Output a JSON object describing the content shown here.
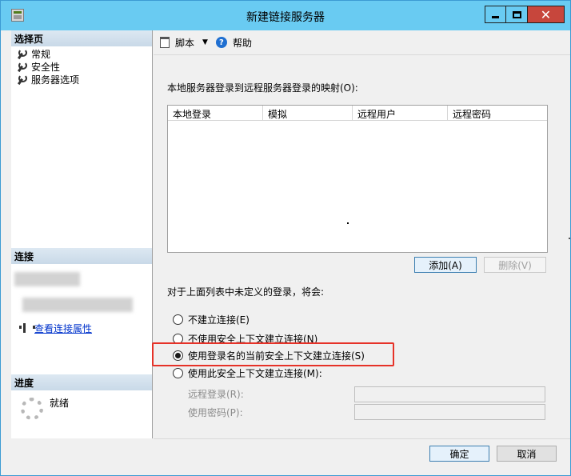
{
  "window": {
    "title": "新建链接服务器",
    "close_glyph": "✕"
  },
  "left_panel": {
    "select_page_header": "选择页",
    "pages": [
      "常规",
      "安全性",
      "服务器选项"
    ],
    "connection_header": "连接",
    "view_connection_link": "查看连接属性",
    "progress_header": "进度",
    "progress_status": "就绪"
  },
  "toolbar": {
    "script_label": "脚本",
    "dropdown_arrow": "▼",
    "help_glyph": "?",
    "help_label": "帮助"
  },
  "mapping": {
    "label": "本地服务器登录到远程服务器登录的映射(O):",
    "columns": [
      "本地登录",
      "模拟",
      "远程用户",
      "远程密码"
    ],
    "add_button": "添加(A)",
    "remove_button": "删除(V)"
  },
  "undefined_logins": {
    "label": "对于上面列表中未定义的登录，将会:",
    "options": [
      {
        "label": "不建立连接(E)",
        "checked": false
      },
      {
        "label": "不使用安全上下文建立连接(N)",
        "checked": false
      },
      {
        "label": "使用登录名的当前安全上下文建立连接(S)",
        "checked": true
      },
      {
        "label": "使用此安全上下文建立连接(M):",
        "checked": false
      }
    ],
    "remote_login_label": "远程登录(R):",
    "password_label": "使用密码(P):"
  },
  "footer": {
    "ok_button": "确定",
    "cancel_button": "取消"
  },
  "colors": {
    "titlebar": "#69cbf2",
    "highlight": "#e63228",
    "close": "#c7463c"
  },
  "icons": [
    "app-icon",
    "minimize-icon",
    "maximize-icon",
    "close-icon",
    "wrench-icon",
    "connection-icon",
    "script-icon",
    "help-icon",
    "spinner-icon"
  ]
}
